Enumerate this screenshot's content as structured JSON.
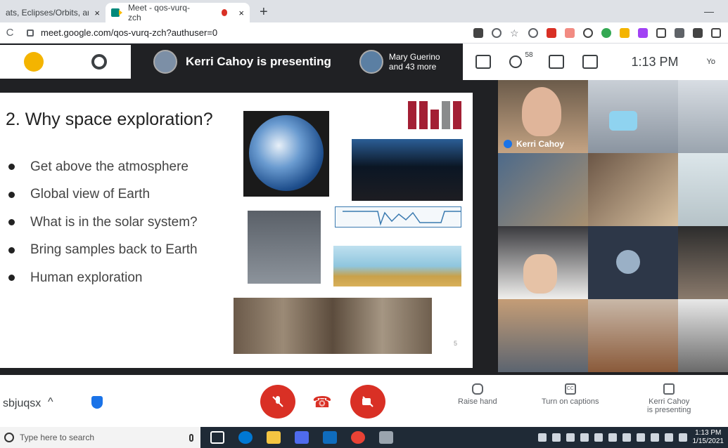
{
  "browser": {
    "tabs": [
      {
        "title": "ats, Eclipses/Orbits, and Sc"
      },
      {
        "title": "Meet - qos-vurq-zch"
      }
    ],
    "url": "meet.google.com/qos-vurq-zch?authuser=0",
    "new_tab": "+",
    "tab_close": "×",
    "reload": "C"
  },
  "meet_header": {
    "presenting_text": "Kerri Cahoy is presenting",
    "others_name": "Mary Guerino",
    "others_more": "and 43 more",
    "participant_count": "58",
    "time": "1:13 PM",
    "you_label": "Yo"
  },
  "slide": {
    "title": "2. Why space exploration?",
    "bullets": [
      "Get above the atmosphere",
      "Global view of Earth",
      "What is in the solar system?",
      "Bring samples back to Earth",
      "Human exploration"
    ],
    "page_number": "5"
  },
  "video": {
    "main_speaker": "Kerri Cahoy"
  },
  "controls": {
    "meeting_code": "sbjuqsx",
    "raise_hand": "Raise hand",
    "captions": "Turn on captions",
    "presenter_line1": "Kerri Cahoy",
    "presenter_line2": "is presenting",
    "cc_label": "CC"
  },
  "taskbar": {
    "search_placeholder": "Type here to search",
    "time": "1:13 PM",
    "date": "1/15/2021"
  },
  "colors": {
    "mit_red": "#a31f34",
    "meet_red": "#d93025",
    "accent_blue": "#1a73e8"
  }
}
